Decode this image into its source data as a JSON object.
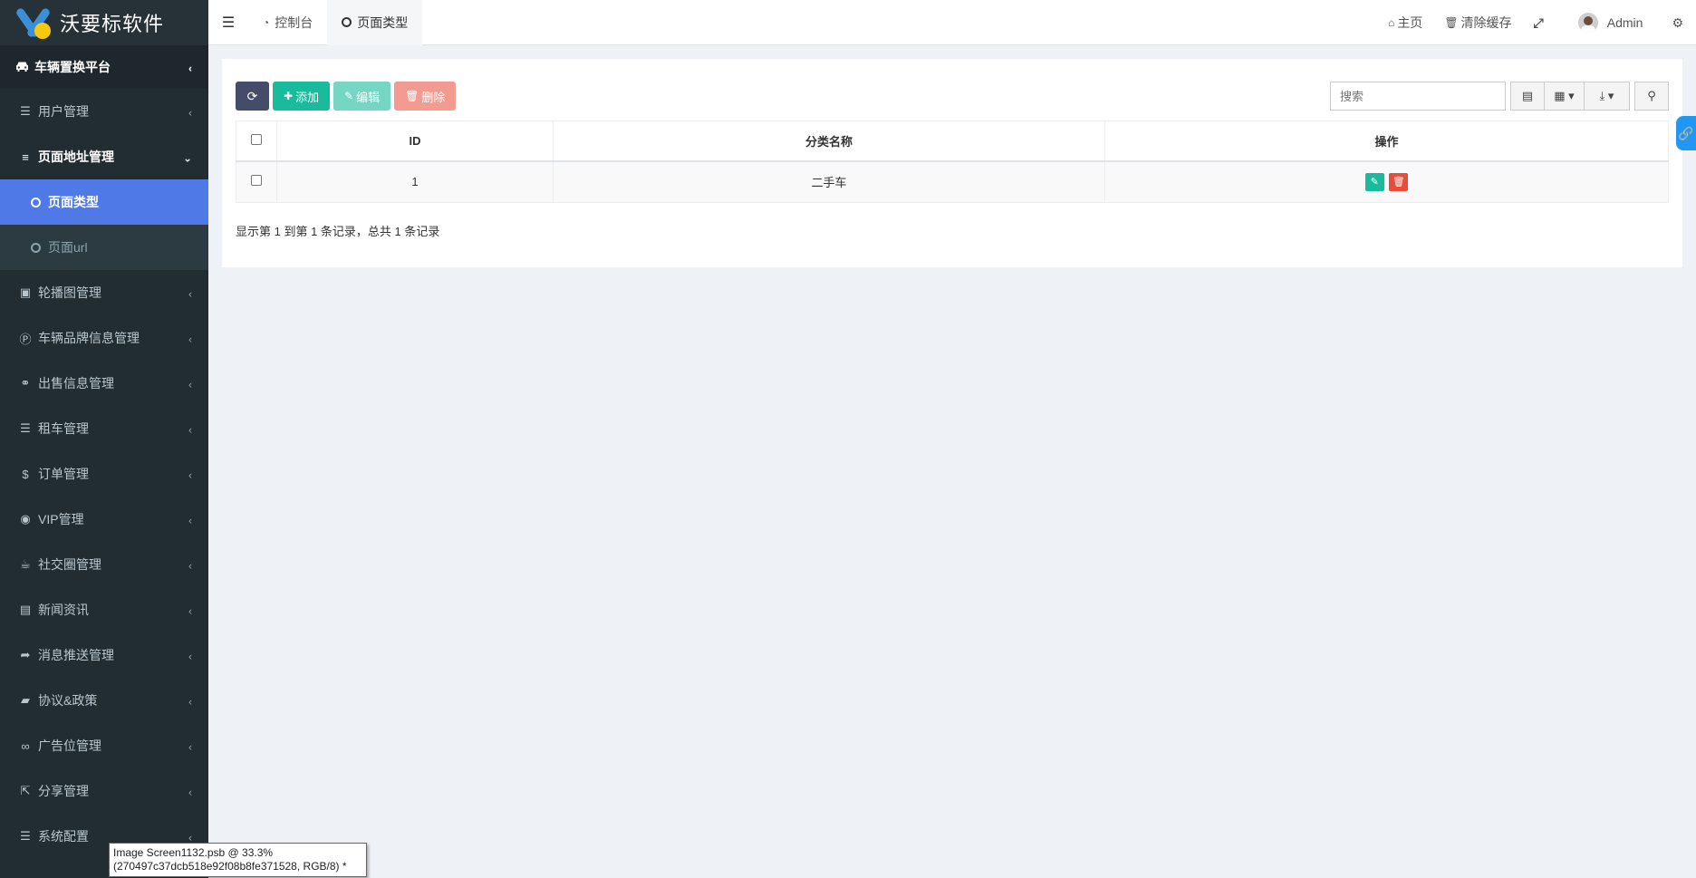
{
  "logo": {
    "text": "沃要标软件"
  },
  "sidebar": {
    "header": {
      "label": "车辆置换平台",
      "icon": "car-icon"
    },
    "items": [
      {
        "label": "用户管理",
        "icon": "list-icon"
      },
      {
        "label": "页面地址管理",
        "icon": "bars-icon",
        "open": true,
        "children": [
          {
            "label": "页面类型",
            "active": true
          },
          {
            "label": "页面url",
            "active": false
          }
        ]
      },
      {
        "label": "轮播图管理",
        "icon": "image-icon"
      },
      {
        "label": "车辆品牌信息管理",
        "icon": "parking-icon"
      },
      {
        "label": "出售信息管理",
        "icon": "handshake-icon"
      },
      {
        "label": "租车管理",
        "icon": "list-icon"
      },
      {
        "label": "订单管理",
        "icon": "dollar-icon"
      },
      {
        "label": "VIP管理",
        "icon": "user-circle-icon"
      },
      {
        "label": "社交圈管理",
        "icon": "coffee-icon"
      },
      {
        "label": "新闻资讯",
        "icon": "file-icon"
      },
      {
        "label": "消息推送管理",
        "icon": "share-icon"
      },
      {
        "label": "协议&政策",
        "icon": "book-icon"
      },
      {
        "label": "广告位管理",
        "icon": "binoculars-icon"
      },
      {
        "label": "分享管理",
        "icon": "share-square-icon"
      },
      {
        "label": "系统配置",
        "icon": "list-icon"
      }
    ]
  },
  "topbar": {
    "tabs": [
      {
        "label": "控制台",
        "icon": "dashboard-icon"
      },
      {
        "label": "页面类型",
        "icon": "circle-icon"
      }
    ],
    "home_label": "主页",
    "clear_cache_label": "清除缓存",
    "user_name": "Admin"
  },
  "toolbar": {
    "add_label": "添加",
    "edit_label": "编辑",
    "delete_label": "删除",
    "search_placeholder": "搜索"
  },
  "table": {
    "headers": [
      "ID",
      "分类名称",
      "操作"
    ],
    "rows": [
      {
        "id": "1",
        "name": "二手车"
      }
    ]
  },
  "pagination": {
    "text": "显示第 1 到第 1 条记录，总共 1 条记录"
  },
  "tooltip": {
    "line1": "Image Screen1132.psb @ 33.3%",
    "line2": "(270497c37dcb518e92f08b8fe371528, RGB/8) *"
  },
  "colors": {
    "sidebar_bg": "#222d32",
    "active_item": "#4e79e6",
    "add_button": "#18bc9c",
    "delete_button": "#e74c3c",
    "refresh_button": "#444c69"
  }
}
